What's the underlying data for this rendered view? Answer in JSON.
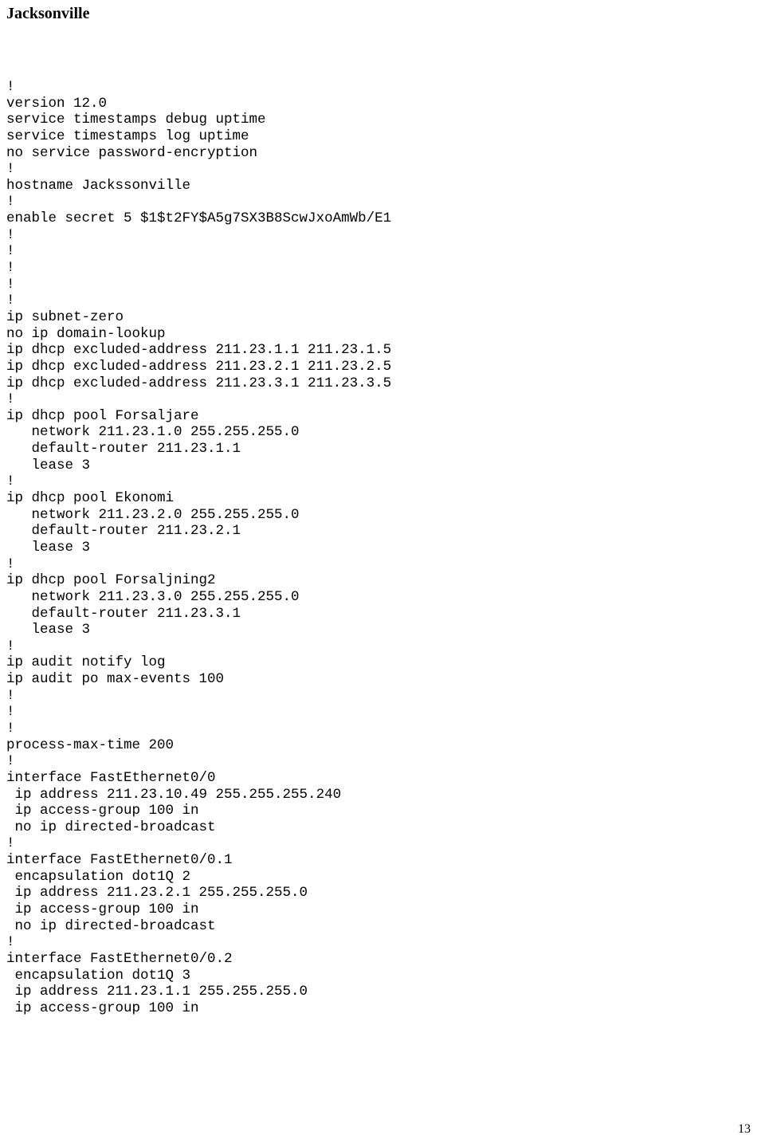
{
  "title": "Jacksonville",
  "config_lines": [
    "!",
    "version 12.0",
    "service timestamps debug uptime",
    "service timestamps log uptime",
    "no service password-encryption",
    "!",
    "hostname Jackssonville",
    "!",
    "enable secret 5 $1$t2FY$A5g7SX3B8ScwJxoAmWb/E1",
    "!",
    "!",
    "!",
    "!",
    "!",
    "ip subnet-zero",
    "no ip domain-lookup",
    "ip dhcp excluded-address 211.23.1.1 211.23.1.5",
    "ip dhcp excluded-address 211.23.2.1 211.23.2.5",
    "ip dhcp excluded-address 211.23.3.1 211.23.3.5",
    "!",
    "ip dhcp pool Forsaljare",
    "   network 211.23.1.0 255.255.255.0",
    "   default-router 211.23.1.1",
    "   lease 3",
    "!",
    "ip dhcp pool Ekonomi",
    "   network 211.23.2.0 255.255.255.0",
    "   default-router 211.23.2.1",
    "   lease 3",
    "!",
    "ip dhcp pool Forsaljning2",
    "   network 211.23.3.0 255.255.255.0",
    "   default-router 211.23.3.1",
    "   lease 3",
    "!",
    "ip audit notify log",
    "ip audit po max-events 100",
    "!",
    "!",
    "!",
    "process-max-time 200",
    "!",
    "interface FastEthernet0/0",
    " ip address 211.23.10.49 255.255.255.240",
    " ip access-group 100 in",
    " no ip directed-broadcast",
    "!",
    "interface FastEthernet0/0.1",
    " encapsulation dot1Q 2",
    " ip address 211.23.2.1 255.255.255.0",
    " ip access-group 100 in",
    " no ip directed-broadcast",
    "!",
    "interface FastEthernet0/0.2",
    " encapsulation dot1Q 3",
    " ip address 211.23.1.1 255.255.255.0",
    " ip access-group 100 in"
  ],
  "page_number": "13"
}
